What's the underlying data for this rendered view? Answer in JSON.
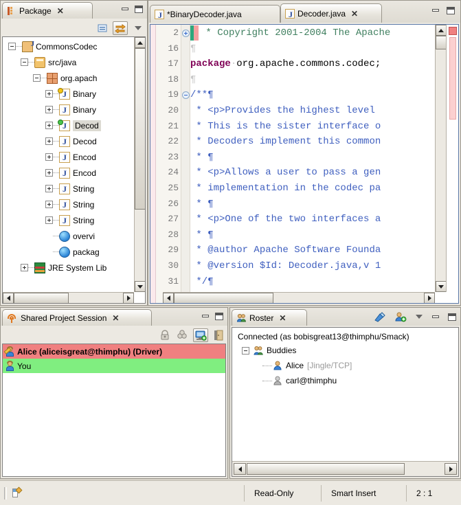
{
  "package_explorer": {
    "tab_label": "Package",
    "tab_icon": "package-explorer-icon",
    "toolbar": {
      "collapse_all": "collapse-all-icon",
      "link_with_editor": "link-with-editor-icon",
      "view_menu": "view-menu-icon"
    },
    "window_buttons": {
      "minimize": "minimize-icon",
      "maximize": "maximize-icon"
    },
    "tree": [
      {
        "label": "CommonsCodec",
        "indent": 0,
        "expander": "minus",
        "icon": "java-project-icon",
        "badge": ""
      },
      {
        "label": "src/java",
        "indent": 1,
        "expander": "minus",
        "icon": "source-folder-icon",
        "badge": ""
      },
      {
        "label": "org.apach",
        "indent": 2,
        "expander": "minus",
        "icon": "package-icon",
        "badge": ""
      },
      {
        "label": "Binary",
        "indent": 3,
        "expander": "plus",
        "icon": "java-file-icon",
        "badge": "yellow"
      },
      {
        "label": "Binary",
        "indent": 3,
        "expander": "plus",
        "icon": "java-file-icon",
        "badge": ""
      },
      {
        "label": "Decod",
        "indent": 3,
        "expander": "plus",
        "icon": "java-file-icon",
        "badge": "green",
        "selected": true
      },
      {
        "label": "Decod",
        "indent": 3,
        "expander": "plus",
        "icon": "java-file-icon",
        "badge": ""
      },
      {
        "label": "Encod",
        "indent": 3,
        "expander": "plus",
        "icon": "java-file-icon",
        "badge": ""
      },
      {
        "label": "Encod",
        "indent": 3,
        "expander": "plus",
        "icon": "java-file-icon",
        "badge": ""
      },
      {
        "label": "String",
        "indent": 3,
        "expander": "plus",
        "icon": "java-file-icon",
        "badge": ""
      },
      {
        "label": "String",
        "indent": 3,
        "expander": "plus",
        "icon": "java-file-icon",
        "badge": ""
      },
      {
        "label": "String",
        "indent": 3,
        "expander": "plus",
        "icon": "java-file-icon",
        "badge": ""
      },
      {
        "label": "overvi",
        "indent": 3,
        "expander": "none",
        "icon": "html-file-icon",
        "badge": ""
      },
      {
        "label": "packag",
        "indent": 3,
        "expander": "none",
        "icon": "html-file-icon",
        "badge": ""
      },
      {
        "label": "JRE System Lib",
        "indent": 1,
        "expander": "plus",
        "icon": "jre-library-icon",
        "badge": ""
      }
    ]
  },
  "editor": {
    "tabs": [
      {
        "label": "*BinaryDecoder.java",
        "active": false,
        "icon": "java-file-icon",
        "closeable": false
      },
      {
        "label": "Decoder.java",
        "active": true,
        "icon": "java-file-icon",
        "closeable": true
      }
    ],
    "window_buttons": {
      "minimize": "minimize-icon",
      "maximize": "maximize-icon"
    },
    "lines": [
      {
        "num": "2",
        "fold": "plus",
        "current": true,
        "text": " * Copyright 2001-2004 The Apache",
        "style": "comment"
      },
      {
        "num": "16",
        "fold": "",
        "text": "¶",
        "style": "pilcrow"
      },
      {
        "num": "17",
        "fold": "",
        "text": "package org.apache.commons.codec;",
        "style": "package"
      },
      {
        "num": "18",
        "fold": "",
        "text": "¶",
        "style": "pilcrow"
      },
      {
        "num": "19",
        "fold": "minus",
        "text": "/**¶",
        "style": "javadoc"
      },
      {
        "num": "20",
        "fold": "",
        "text": " * <p>Provides the highest level ",
        "style": "javadoc"
      },
      {
        "num": "21",
        "fold": "",
        "text": " * This is the sister interface o",
        "style": "javadoc"
      },
      {
        "num": "22",
        "fold": "",
        "text": " * Decoders implement this common",
        "style": "javadoc"
      },
      {
        "num": "23",
        "fold": "",
        "text": " * ¶",
        "style": "javadoc"
      },
      {
        "num": "24",
        "fold": "",
        "text": " * <p>Allows a user to pass a gen",
        "style": "javadoc"
      },
      {
        "num": "25",
        "fold": "",
        "text": " * implementation in the codec pa",
        "style": "javadoc"
      },
      {
        "num": "26",
        "fold": "",
        "text": " * ¶",
        "style": "javadoc"
      },
      {
        "num": "27",
        "fold": "",
        "text": " * <p>One of the two interfaces a",
        "style": "javadoc"
      },
      {
        "num": "28",
        "fold": "",
        "text": " * ¶",
        "style": "javadoc"
      },
      {
        "num": "29",
        "fold": "",
        "text": " * @author Apache Software Founda",
        "style": "javadoc"
      },
      {
        "num": "30",
        "fold": "",
        "text": " * @version $Id: Decoder.java,v 1",
        "style": "javadoc"
      },
      {
        "num": "31",
        "fold": "",
        "text": " */¶",
        "style": "javadoc"
      }
    ]
  },
  "session_view": {
    "tab_label": "Shared Project Session",
    "tab_icon": "saros-session-icon",
    "toolbar": [
      {
        "name": "follow-mode-icon",
        "pressed": false
      },
      {
        "name": "share-project-icon",
        "pressed": false
      },
      {
        "name": "open-invitation-icon",
        "pressed": true
      },
      {
        "name": "leave-session-icon",
        "pressed": false
      }
    ],
    "window_buttons": {
      "minimize": "minimize-icon",
      "maximize": "maximize-icon"
    },
    "participants": [
      {
        "label": "Alice (aliceisgreat@thimphu) (Driver)",
        "role": "driver",
        "highlight": "#f08080"
      },
      {
        "label": "You",
        "role": "you",
        "highlight": "#80ee80"
      }
    ]
  },
  "roster_view": {
    "tab_label": "Roster",
    "tab_icon": "roster-icon",
    "toolbar": [
      {
        "name": "connect-icon"
      },
      {
        "name": "add-contact-icon"
      },
      {
        "name": "view-menu-icon"
      }
    ],
    "window_buttons": {
      "minimize": "minimize-icon",
      "maximize": "maximize-icon"
    },
    "status_text": "Connected (as bobisgreat13@thimphu/Smack)",
    "tree": [
      {
        "label": "Buddies",
        "suffix": "",
        "indent": 0,
        "expander": "minus",
        "icon": "group-icon"
      },
      {
        "label": "Alice",
        "suffix": "[Jingle/TCP]",
        "indent": 1,
        "expander": "none",
        "icon": "user-online-icon"
      },
      {
        "label": "carl@thimphu",
        "suffix": "",
        "indent": 1,
        "expander": "none",
        "icon": "user-offline-icon"
      }
    ]
  },
  "status_bar": {
    "icon": "java-editor-status-icon",
    "read_only": "Read-Only",
    "insert_mode": "Smart Insert",
    "cursor_position": "2 : 1"
  }
}
